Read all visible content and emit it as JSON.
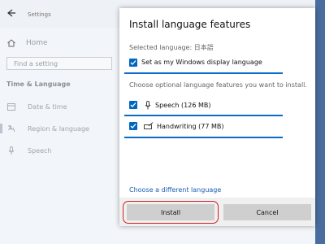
{
  "settings": {
    "title": "Settings",
    "home": "Home",
    "search_placeholder": "Find a setting",
    "section": "Time & Language",
    "nav": [
      {
        "label": "Date & time",
        "icon": "calendar-icon"
      },
      {
        "label": "Region & language",
        "icon": "region-icon"
      },
      {
        "label": "Speech",
        "icon": "microphone-icon"
      }
    ]
  },
  "dialog": {
    "title": "Install language features",
    "selected_language": "Selected language: 日本語",
    "display_language_checkbox": {
      "label": "Set as my Windows display language",
      "checked": true
    },
    "optional_prompt": "Choose optional language features you want to install.",
    "features": [
      {
        "label": "Speech (126 MB)",
        "icon": "microphone-icon",
        "checked": true
      },
      {
        "label": "Handwriting (77 MB)",
        "icon": "handwriting-icon",
        "checked": true
      }
    ],
    "link": "Choose a different language",
    "buttons": {
      "install": "Install",
      "cancel": "Cancel"
    }
  },
  "colors": {
    "accent": "#0067c0",
    "highlight_ring": "#d02020"
  }
}
